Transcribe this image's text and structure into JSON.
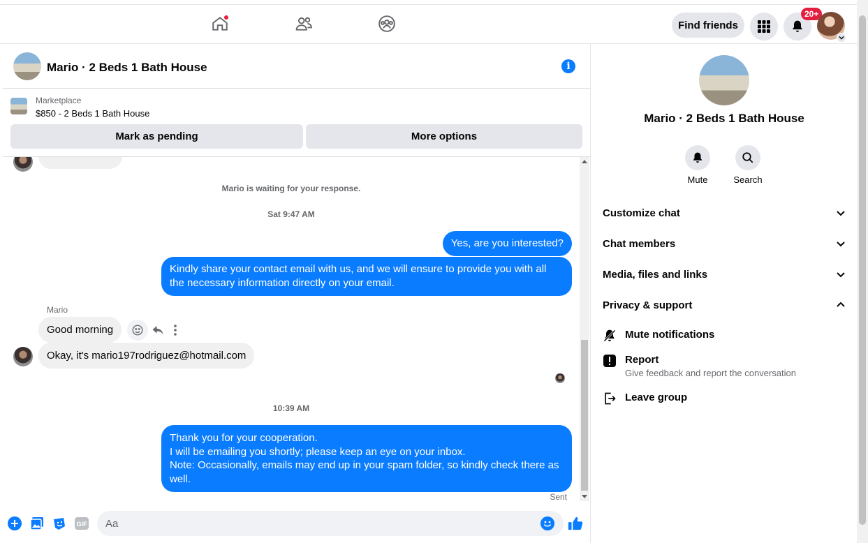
{
  "topbar": {
    "find_friends": "Find friends",
    "notif_count": "20+"
  },
  "conversation": {
    "title": "Mario · 2 Beds 1 Bath House"
  },
  "marketplace": {
    "label": "Marketplace",
    "item": "$850 - 2 Beds 1 Bath House",
    "pending_button": "Mark as pending",
    "more_button": "More options"
  },
  "messages": {
    "waiting": "Mario is waiting for your response.",
    "time1": "Sat 9:47 AM",
    "out1": "Yes, are you interested?",
    "out2": "Kindly share your contact email with us, and we will ensure to provide you with all the necessary information directly on your email.",
    "sender": "Mario",
    "in1": "Good morning",
    "in2": "Okay, it's mario197rodriguez@hotmail.com",
    "time2": "10:39 AM",
    "out3_lines": [
      "Thank you for your cooperation.",
      "I will be emailing you shortly; please keep an eye on your inbox.",
      "Note: Occasionally, emails may end up in your spam folder, so kindly check there as well."
    ],
    "status": "Sent"
  },
  "composer": {
    "placeholder": "Aa"
  },
  "sidebar": {
    "title": "Mario · 2 Beds 1 Bath House",
    "mute": "Mute",
    "search": "Search",
    "sections": [
      "Customize chat",
      "Chat members",
      "Media, files and links",
      "Privacy & support"
    ],
    "mute_notifications": "Mute notifications",
    "report": "Report",
    "report_sub": "Give feedback and report the conversation",
    "leave_group": "Leave group"
  },
  "colors": {
    "accent": "#0a7cff",
    "badge": "#e41e3f"
  }
}
